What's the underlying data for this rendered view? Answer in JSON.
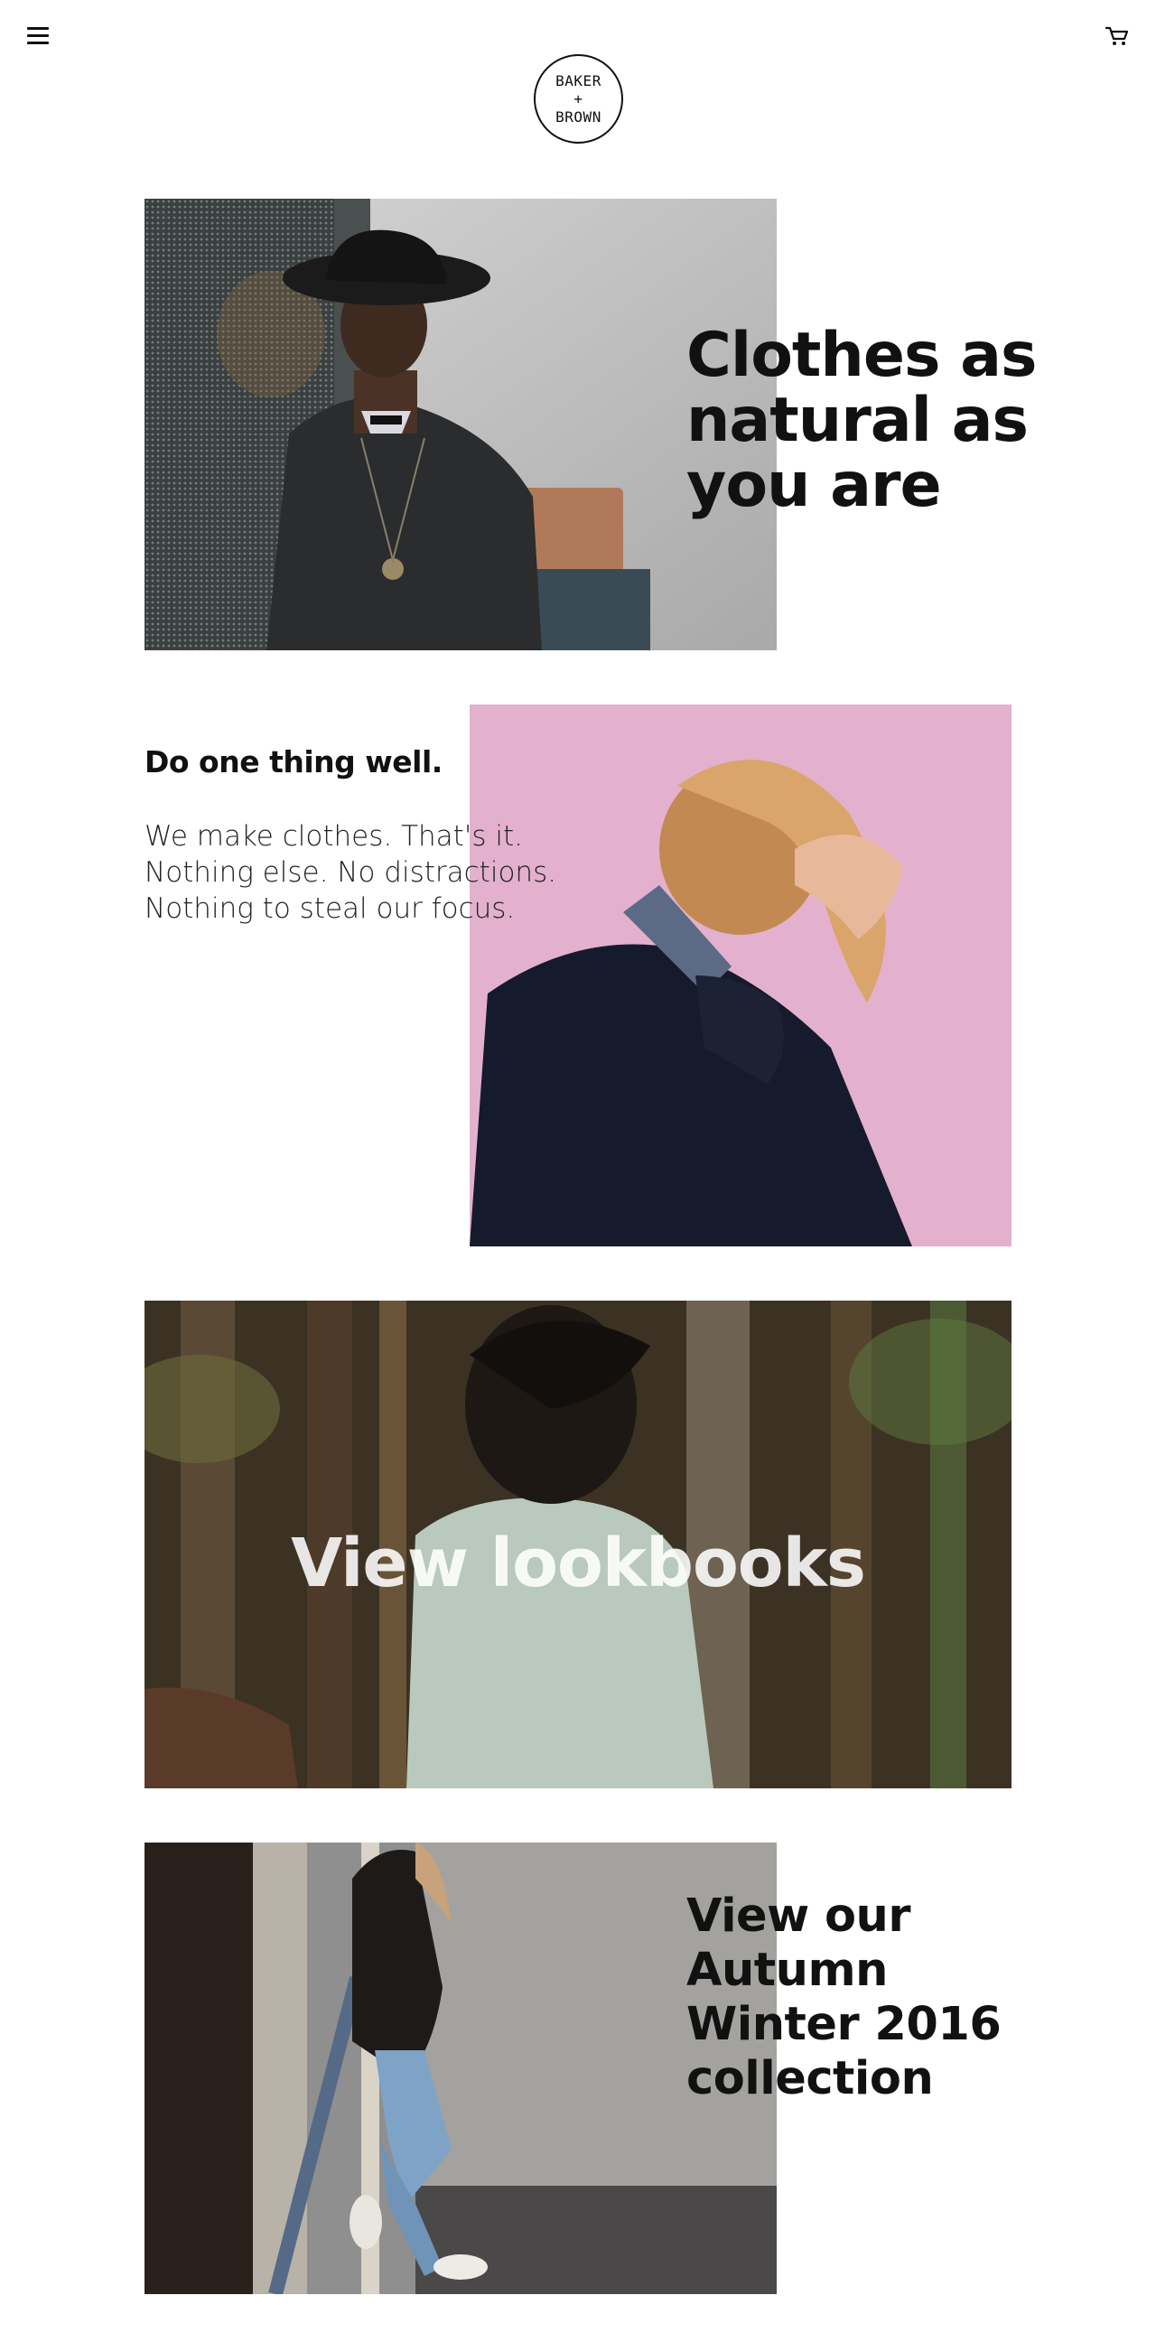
{
  "header": {
    "menu_icon": "hamburger-menu-icon",
    "cart_icon": "shopping-cart-icon",
    "logo": {
      "line1": "BAKER",
      "line2": "+",
      "line3": "BROWN"
    }
  },
  "hero": {
    "title": "Clothes as natural as you are",
    "image": "man-in-black-hat-photo"
  },
  "mission": {
    "heading": "Do one thing well.",
    "body": [
      "We make clothes. That's it.",
      "Nothing else. No distractions.",
      "Nothing to steal our focus."
    ],
    "image": "man-hand-on-hair-pink-wall-photo"
  },
  "lookbook": {
    "label": "View lookbooks",
    "image": "woman-in-forest-denim-shirt-photo"
  },
  "collection": {
    "label": "View our Autumn Winter 2016 collection",
    "image": "woman-leaning-on-railing-photo"
  },
  "colors": {
    "text": "#111111",
    "background": "#ffffff",
    "pink_wall": "#e3b1cd"
  }
}
